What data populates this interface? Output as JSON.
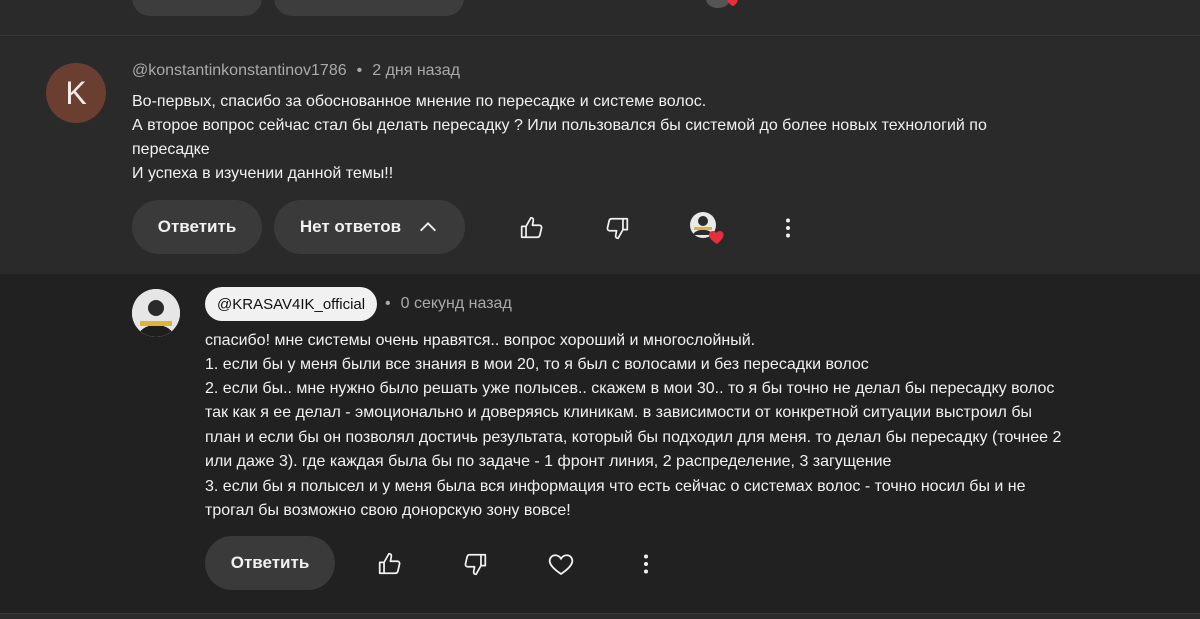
{
  "comment": {
    "avatar_letter": "K",
    "author": "@konstantinkonstantinov1786",
    "separator": "•",
    "time": "2 дня назад",
    "lines": [
      "Во-первых, спасибо за обоснованное мнение по пересадке  и системе волос.",
      "А второе вопрос сейчас стал бы делать пересадку ? Или пользовался бы системой до более новых технологий по",
      "пересадке",
      "И успеха в изучении данной темы!!"
    ],
    "reply_button": "Ответить",
    "replies_button": "Нет ответов"
  },
  "reply": {
    "author": "@KRASAV4IK_official",
    "separator": "•",
    "time": "0 секунд назад",
    "lines": [
      "спасибо! мне системы очень нравятся.. вопрос хороший и многослойный.",
      "1. если бы у меня были все знания в мои 20, то я был с волосами и без пересадки волос",
      "2. если бы.. мне нужно было решать уже полысев.. скажем в мои 30.. то я бы точно не делал бы пересадку волос",
      "так как я ее делал - эмоционально и доверяясь клиникам. в зависимости от конкретной ситуации выстроил бы",
      "план и если бы он позволял достичь результата, который бы подходил для меня. то делал бы пересадку (точнее 2",
      "или даже 3). где каждая была бы по задаче - 1 фронт линия, 2 распределение, 3 загущение",
      "3. если бы я полысел и у меня была вся информация что есть сейчас о системах волос - точно носил бы и не",
      "трогал бы возможно свою донорскую зону вовсе!"
    ],
    "reply_button": "Ответить"
  },
  "colors": {
    "heart": "#e62e3d",
    "avatar_k": "#6b3e32"
  },
  "icons": [
    "thumbs-up-icon",
    "thumbs-down-icon",
    "heart-icon",
    "more-vert-icon",
    "chevron-up-icon"
  ]
}
